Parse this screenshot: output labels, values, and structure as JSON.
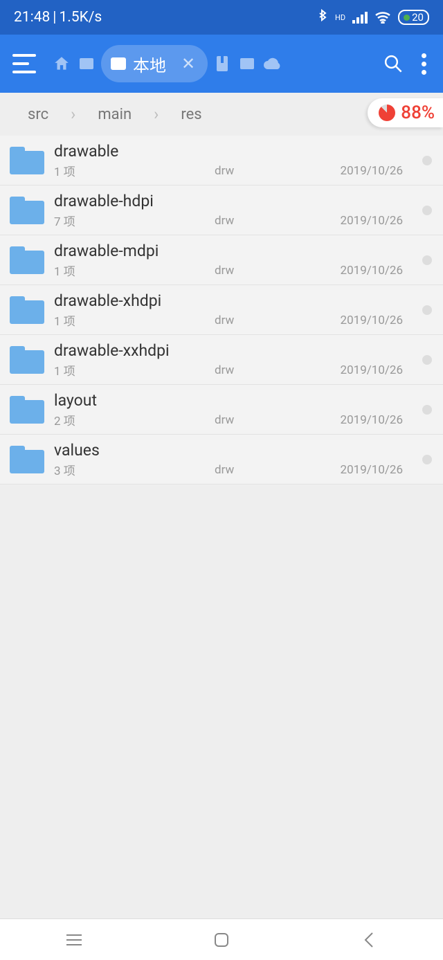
{
  "status": {
    "time": "21:48",
    "sep": "|",
    "speed": "1.5K/s",
    "hd": "HD",
    "battery": "20"
  },
  "toolbar": {
    "tab_label": "本地"
  },
  "breadcrumb": {
    "items": [
      "src",
      "main",
      "res"
    ]
  },
  "storage": {
    "percent": "88%"
  },
  "items": [
    {
      "name": "drawable",
      "count": "1 项",
      "perm": "drw",
      "date": "2019/10/26"
    },
    {
      "name": "drawable-hdpi",
      "count": "7 项",
      "perm": "drw",
      "date": "2019/10/26"
    },
    {
      "name": "drawable-mdpi",
      "count": "1 项",
      "perm": "drw",
      "date": "2019/10/26"
    },
    {
      "name": "drawable-xhdpi",
      "count": "1 项",
      "perm": "drw",
      "date": "2019/10/26"
    },
    {
      "name": "drawable-xxhdpi",
      "count": "1 项",
      "perm": "drw",
      "date": "2019/10/26"
    },
    {
      "name": "layout",
      "count": "2 项",
      "perm": "drw",
      "date": "2019/10/26"
    },
    {
      "name": "values",
      "count": "3 项",
      "perm": "drw",
      "date": "2019/10/26"
    }
  ]
}
